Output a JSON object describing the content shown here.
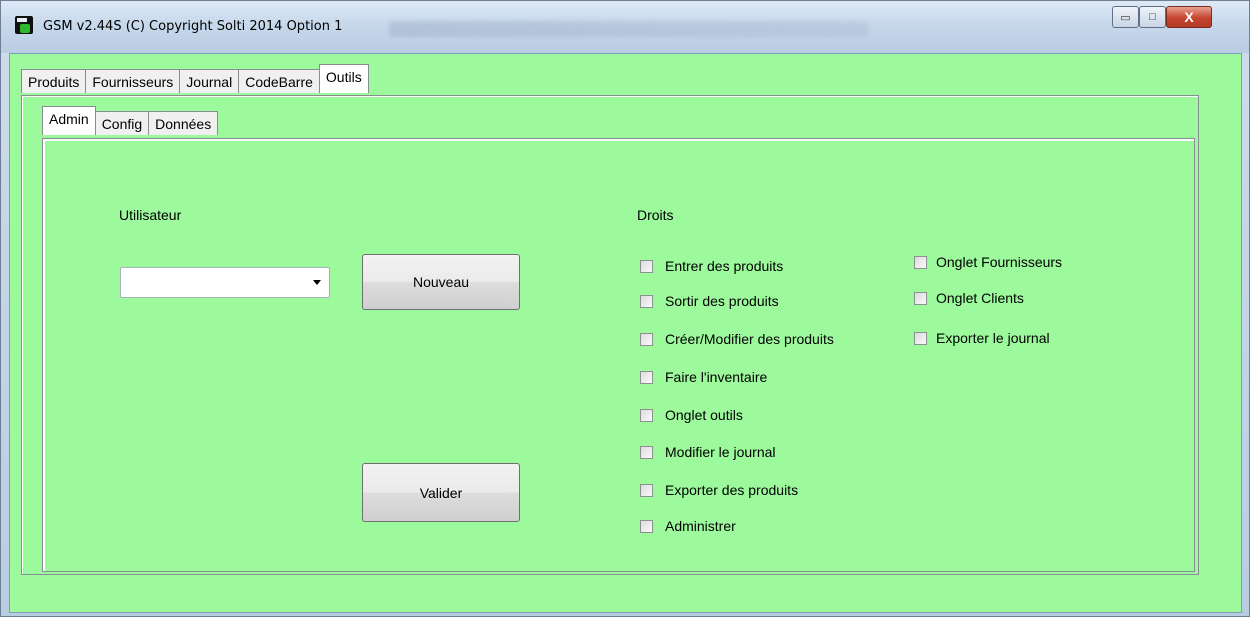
{
  "window": {
    "title": "GSM v2.44S (C) Copyright Solti 2014 Option 1",
    "controls": {
      "minimize": "▭",
      "maximize": "□",
      "close": "X"
    }
  },
  "main_tabs": [
    "Produits",
    "Fournisseurs",
    "Journal",
    "CodeBarre",
    "Outils"
  ],
  "active_main_tab": "Outils",
  "sub_tabs": [
    "Admin",
    "Config",
    "Données"
  ],
  "active_sub_tab": "Admin",
  "admin": {
    "user_label": "Utilisateur",
    "user_select_value": "",
    "new_button": "Nouveau",
    "validate_button": "Valider",
    "rights_label": "Droits",
    "rights_col1": [
      "Entrer des produits",
      "Sortir des produits",
      "Créer/Modifier des produits",
      "Faire l'inventaire",
      "Onglet outils",
      "Modifier le journal",
      "Exporter des produits",
      "Administrer"
    ],
    "rights_col2": [
      "Onglet Fournisseurs",
      "Onglet Clients",
      "Exporter le journal"
    ]
  },
  "colors": {
    "panel_background": "#9cf99c"
  }
}
